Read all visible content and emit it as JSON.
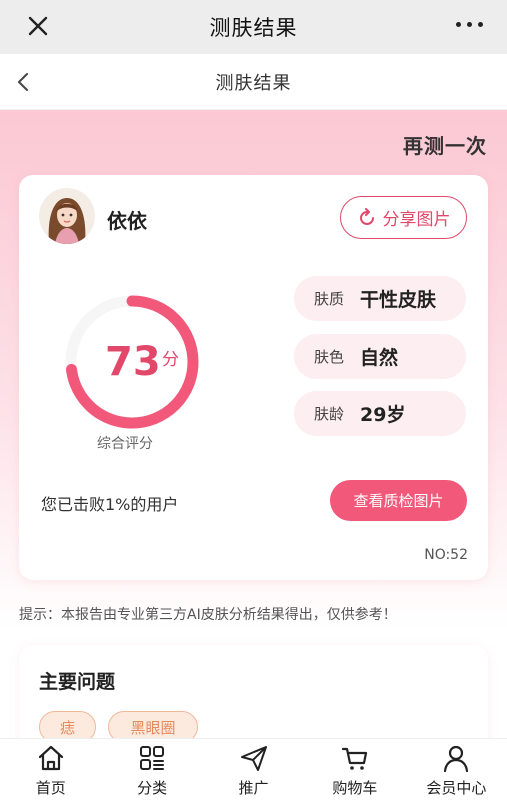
{
  "wechat": {
    "title": "测肤结果"
  },
  "header": {
    "title": "测肤结果"
  },
  "retest_label": "再测一次",
  "profile": {
    "name": "依依",
    "share_label": "分享图片"
  },
  "score": {
    "value": "73",
    "unit": "分",
    "caption": "综合评分",
    "percent": 73
  },
  "attributes": [
    {
      "label": "肤质",
      "value": "干性皮肤"
    },
    {
      "label": "肤色",
      "value": "自然"
    },
    {
      "label": "肤龄",
      "value": "29岁"
    }
  ],
  "beat_text": "您已击败1%的用户",
  "check_button": "查看质检图片",
  "record_no": "NO:52",
  "tip": "提示：本报告由专业第三方AI皮肤分析结果得出，仅供参考！",
  "issues": {
    "title": "主要问题",
    "tags": [
      "痣",
      "黑眼圈"
    ]
  },
  "tabs": [
    {
      "label": "首页",
      "icon": "home-icon"
    },
    {
      "label": "分类",
      "icon": "category-icon"
    },
    {
      "label": "推广",
      "icon": "send-icon"
    },
    {
      "label": "购物车",
      "icon": "cart-icon"
    },
    {
      "label": "会员中心",
      "icon": "user-icon"
    }
  ],
  "colors": {
    "accent": "#e2486a",
    "button": "#f2587a",
    "tag_text": "#e58a5c"
  }
}
